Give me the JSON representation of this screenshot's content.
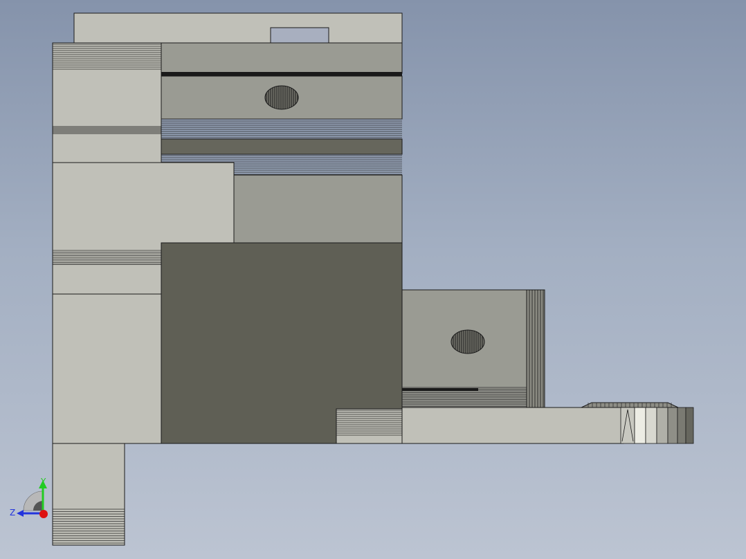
{
  "viewport": {
    "background_top": "#8593ab",
    "background_bottom": "#bcc4d2"
  },
  "colors": {
    "face_light": "#c0c0b8",
    "face_mid": "#9a9b93",
    "face_dark": "#66665c",
    "face_darker": "#5f5f55",
    "edge": "#1a1a1a",
    "hatch": "#2a2a2a",
    "highlight": "#ecece4"
  },
  "triad": {
    "y_label": "Y",
    "z_label": "Z",
    "y_color": "#22cc22",
    "z_color": "#2233dd",
    "x_color": "#dd1111"
  }
}
